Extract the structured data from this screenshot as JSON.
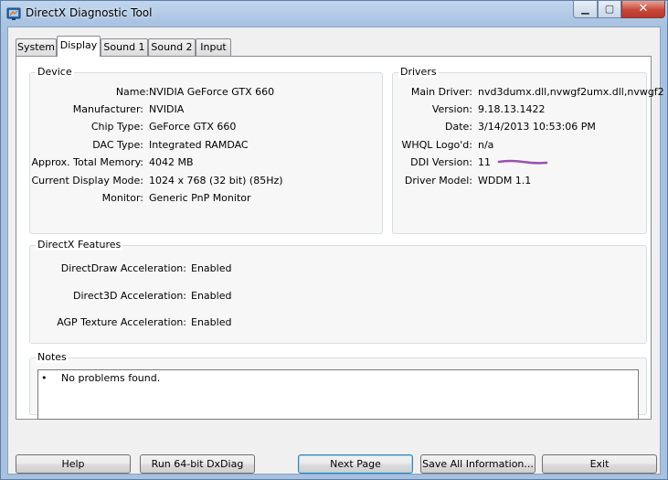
{
  "window": {
    "title": "DirectX Diagnostic Tool",
    "controls": {
      "minimize": "▁",
      "maximize": "▢",
      "close": "✕"
    }
  },
  "tabs": [
    {
      "label": "System",
      "active": false
    },
    {
      "label": "Display",
      "active": true
    },
    {
      "label": "Sound 1",
      "active": false
    },
    {
      "label": "Sound 2",
      "active": false
    },
    {
      "label": "Input",
      "active": false
    }
  ],
  "device": {
    "heading": "Device",
    "rows": [
      {
        "label": "Name:",
        "value": "NVIDIA GeForce GTX 660"
      },
      {
        "label": "Manufacturer:",
        "value": "NVIDIA"
      },
      {
        "label": "Chip Type:",
        "value": "GeForce GTX 660"
      },
      {
        "label": "DAC Type:",
        "value": "Integrated RAMDAC"
      },
      {
        "label": "Approx. Total Memory:",
        "value": "4042 MB"
      },
      {
        "label": "Current Display Mode:",
        "value": "1024 x 768 (32 bit) (85Hz)"
      },
      {
        "label": "Monitor:",
        "value": "Generic PnP Monitor"
      }
    ]
  },
  "drivers": {
    "heading": "Drivers",
    "rows": [
      {
        "label": "Main Driver:",
        "value": "nvd3dumx.dll,nvwgf2umx.dll,nvwgf2"
      },
      {
        "label": "Version:",
        "value": "9.18.13.1422"
      },
      {
        "label": "Date:",
        "value": "3/14/2013 10:53:06 PM"
      },
      {
        "label": "WHQL Logo'd:",
        "value": "n/a"
      },
      {
        "label": "DDI Version:",
        "value": "11"
      },
      {
        "label": "Driver Model:",
        "value": "WDDM 1.1"
      }
    ]
  },
  "features": {
    "heading": "DirectX Features",
    "rows": [
      {
        "label": "DirectDraw Acceleration:",
        "value": "Enabled"
      },
      {
        "label": "Direct3D Acceleration:",
        "value": "Enabled"
      },
      {
        "label": "AGP Texture Acceleration:",
        "value": "Enabled"
      }
    ]
  },
  "notes": {
    "heading": "Notes",
    "bullet": "•",
    "items": [
      "No problems found."
    ]
  },
  "buttons": {
    "help": "Help",
    "run64": "Run 64-bit DxDiag",
    "next": "Next Page",
    "save": "Save All Information...",
    "exit": "Exit"
  },
  "colors": {
    "annotation_mark": "#9b4fb0",
    "title_bar": "#a9c3e2",
    "close_button": "#c7483a"
  }
}
